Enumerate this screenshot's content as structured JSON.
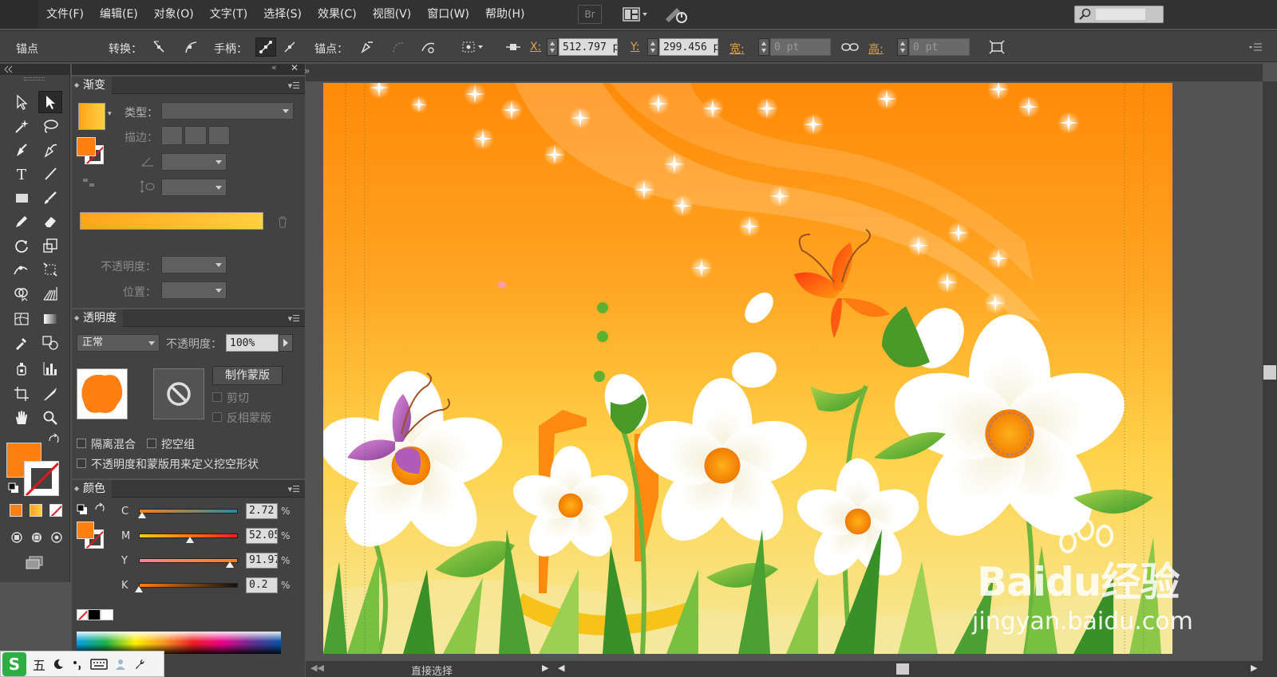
{
  "menubar": {
    "items": [
      "文件(F)",
      "编辑(E)",
      "对象(O)",
      "文字(T)",
      "选择(S)",
      "效果(C)",
      "视图(V)",
      "窗口(W)",
      "帮助(H)"
    ],
    "bridge": "Br"
  },
  "controlbar": {
    "mode_label": "锚点",
    "convert_label": "转换：",
    "handles_label": "手柄：",
    "anchors_label": "锚点：",
    "x_label": "X:",
    "x_value": "512.797 p",
    "y_label": "Y:",
    "y_value": "299.456 p",
    "w_label": "宽:",
    "w_value": "0 pt",
    "h_label": "高:",
    "h_value": "0 pt"
  },
  "gradient_panel": {
    "tab": "渐变",
    "type_label": "类型：",
    "stroke_label": "描边：",
    "opacity_label": "不透明度：",
    "position_label": "位置：",
    "gradient_start": "#ffa51a",
    "gradient_end": "#ffd040"
  },
  "transparency_panel": {
    "tab": "透明度",
    "blend_mode": "正常",
    "opacity_label": "不透明度：",
    "opacity_value": "100%",
    "make_mask": "制作蒙版",
    "clip": "剪切",
    "invert_mask": "反相蒙版",
    "isolate_blending": "隔离混合",
    "knockout_group": "挖空组",
    "opacity_mask_define": "不透明度和蒙版用来定义挖空形状"
  },
  "color_panel": {
    "tab": "颜色",
    "channels": [
      {
        "name": "C",
        "value": "2.72",
        "fraction": 0.03
      },
      {
        "name": "M",
        "value": "52.05",
        "fraction": 0.52
      },
      {
        "name": "Y",
        "value": "91.97",
        "fraction": 0.92
      },
      {
        "name": "K",
        "value": "0.2",
        "fraction": 0.0
      }
    ],
    "unit": "%",
    "fill_color": "#ff7f11"
  },
  "status": {
    "tool": "直接选择"
  },
  "watermark": {
    "brand": "Baidu经验",
    "url": "jingyan.baidu.com"
  },
  "ime": {
    "mode": "五"
  }
}
